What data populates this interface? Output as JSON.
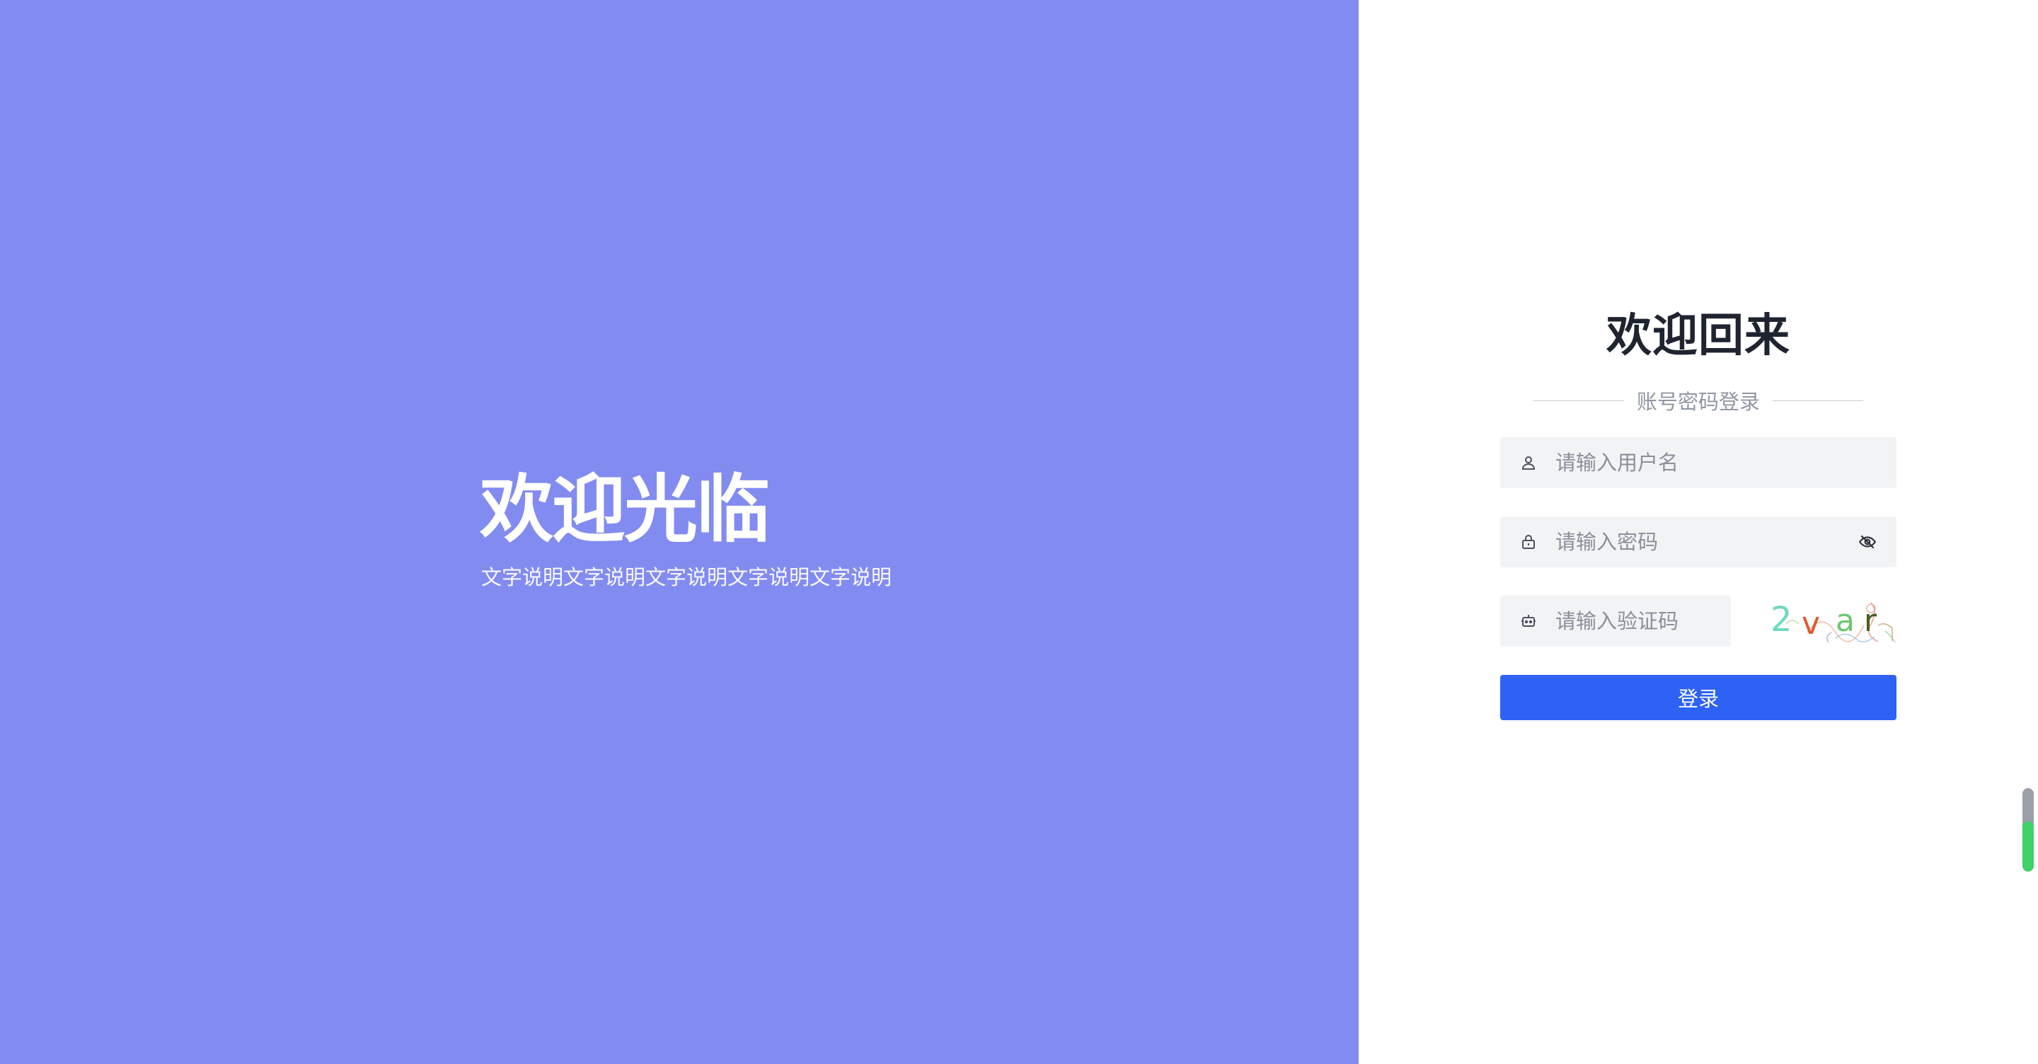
{
  "welcome": {
    "title": "欢迎光临",
    "subtitle": "文字说明文字说明文字说明文字说明文字说明"
  },
  "login": {
    "title": "欢迎回来",
    "divider_label": "账号密码登录",
    "username": {
      "placeholder": "请输入用户名",
      "value": "",
      "icon": "user-icon"
    },
    "password": {
      "placeholder": "请输入密码",
      "value": "",
      "icon": "lock-icon",
      "toggle_icon": "eye-off-icon"
    },
    "captcha": {
      "placeholder": "请输入验证码",
      "value": "",
      "icon": "robot-icon",
      "code": "2var"
    },
    "submit_label": "登录"
  },
  "scrollbar": {
    "fill_fraction": 0.6
  },
  "colors": {
    "left_bg": "#828bf0",
    "primary": "#2e62f5",
    "input_bg": "#f2f3f5",
    "title": "#1f2430",
    "muted": "#9097a3"
  }
}
